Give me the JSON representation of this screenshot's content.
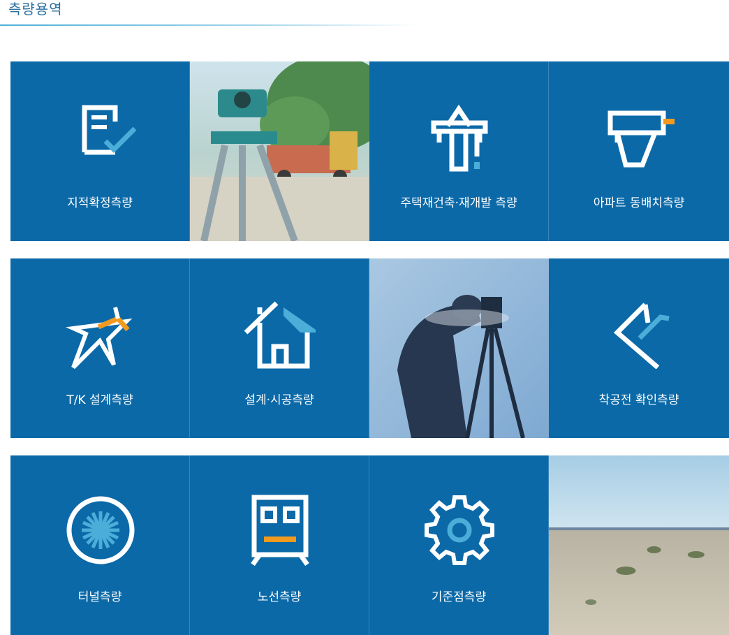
{
  "page": {
    "title": "측량용역"
  },
  "colors": {
    "tile_blue": "#0b69a8",
    "accent_cyan": "#4aaed8",
    "accent_orange": "#f29a1f",
    "icon_white": "#ffffff"
  },
  "services": [
    {
      "label": "지적확정측량",
      "icon": "document-check-icon"
    },
    {
      "label": "주택재건축·재개발 측량",
      "icon": "building-frame-icon"
    },
    {
      "label": "아파트 동배치측량",
      "icon": "survey-gun-icon"
    },
    {
      "label": "T/K 설계측량",
      "icon": "star-flag-icon"
    },
    {
      "label": "설계·시공측량",
      "icon": "house-icon"
    },
    {
      "label": "착공전 확인측량",
      "icon": "check-angle-icon"
    },
    {
      "label": "터널측량",
      "icon": "tunnel-circle-icon"
    },
    {
      "label": "노선측량",
      "icon": "train-front-icon"
    },
    {
      "label": "기준점측량",
      "icon": "gear-icon"
    }
  ],
  "photos": [
    {
      "name": "tripod-level-photo"
    },
    {
      "name": "surveyor-silhouette-photo"
    },
    {
      "name": "open-field-photo"
    }
  ]
}
